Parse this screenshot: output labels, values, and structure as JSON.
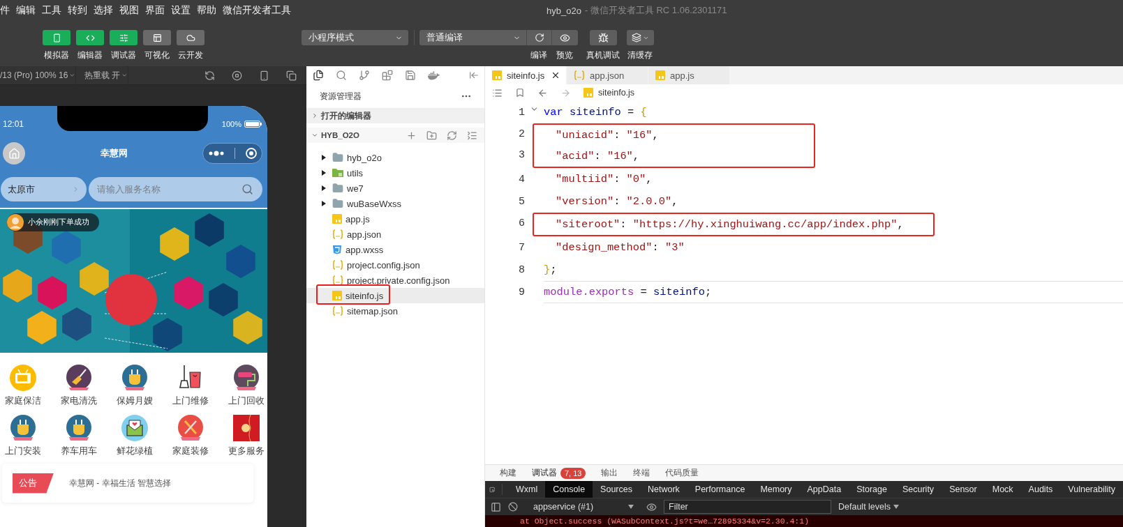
{
  "window": {
    "title": "hyb_o2o",
    "subtitle": "- 微信开发者工具 RC 1.06.2301171"
  },
  "menu": [
    "件",
    "编辑",
    "工具",
    "转到",
    "选择",
    "视图",
    "界面",
    "设置",
    "帮助",
    "微信开发者工具"
  ],
  "toolbar": {
    "views": [
      {
        "label": "模拟器",
        "selected": true
      },
      {
        "label": "编辑器",
        "selected": true
      },
      {
        "label": "调试器",
        "selected": true
      },
      {
        "label": "可视化",
        "selected": false
      },
      {
        "label": "云开发",
        "selected": false
      }
    ],
    "mode_select": "小程序模式",
    "compile_select": "普通编译",
    "actions": [
      {
        "label": "编译"
      },
      {
        "label": "预览"
      },
      {
        "label": "真机调试"
      },
      {
        "label": "清缓存"
      }
    ]
  },
  "simulator": {
    "device": "/13 (Pro) 100% 16",
    "hot_reload": "热重载 开",
    "phone": {
      "time": "12:01",
      "battery": "100%",
      "title": "幸慧网",
      "city": "太原市",
      "search_placeholder": "请输入服务名称",
      "toast": "小佘刚刚下单成功",
      "services": [
        {
          "label": "家庭保洁",
          "kind": "tv"
        },
        {
          "label": "家电清洗",
          "kind": "broom"
        },
        {
          "label": "保姆月嫂",
          "kind": "plug"
        },
        {
          "label": "上门维修",
          "kind": "bucket"
        },
        {
          "label": "上门回收",
          "kind": "roller"
        },
        {
          "label": "上门安装",
          "kind": "plug"
        },
        {
          "label": "养车用车",
          "kind": "plug"
        },
        {
          "label": "鲜花绿植",
          "kind": "envelope"
        },
        {
          "label": "家庭装修",
          "kind": "tools"
        },
        {
          "label": "更多服务",
          "kind": "packet"
        }
      ],
      "notice": {
        "badge": "公告",
        "text": "幸慧网 - 幸福生活 智慧选择"
      }
    }
  },
  "explorer": {
    "title": "资源管理器",
    "open_editors": {
      "label": "打开的编辑器",
      "expanded": false
    },
    "project": {
      "label": "HYB_O2O",
      "expanded": true,
      "children": [
        {
          "label": "hyb_o2o",
          "kind": "folder",
          "expanded": false,
          "selected": false,
          "highlighted": false
        },
        {
          "label": "utils",
          "kind": "folder-green",
          "expanded": false,
          "selected": false,
          "highlighted": false
        },
        {
          "label": "we7",
          "kind": "folder",
          "expanded": false,
          "selected": false,
          "highlighted": false
        },
        {
          "label": "wuBaseWxss",
          "kind": "folder",
          "expanded": false,
          "selected": false,
          "highlighted": false
        },
        {
          "label": "app.js",
          "kind": "js",
          "selected": false,
          "highlighted": false
        },
        {
          "label": "app.json",
          "kind": "json",
          "selected": false,
          "highlighted": false
        },
        {
          "label": "app.wxss",
          "kind": "css",
          "selected": false,
          "highlighted": false
        },
        {
          "label": "project.config.json",
          "kind": "json",
          "selected": false,
          "highlighted": false
        },
        {
          "label": "project.private.config.json",
          "kind": "json",
          "selected": false,
          "highlighted": false
        },
        {
          "label": "siteinfo.js",
          "kind": "js",
          "selected": true,
          "highlighted": true
        },
        {
          "label": "sitemap.json",
          "kind": "json",
          "selected": false,
          "highlighted": false
        }
      ]
    }
  },
  "editor": {
    "tabs": [
      {
        "label": "siteinfo.js",
        "kind": "js",
        "selected": true
      },
      {
        "label": "app.json",
        "kind": "json",
        "selected": false
      },
      {
        "label": "app.js",
        "kind": "js",
        "selected": false
      }
    ],
    "breadcrumb": {
      "label": "siteinfo.js",
      "kind": "js"
    },
    "line_groups": [
      {
        "highlighted": false,
        "lines": [
          {
            "number": "1",
            "foldable": true,
            "indented": false,
            "current": false,
            "tokens": [
              {
                "kind": "keyword",
                "text": "var"
              },
              {
                "kind": "ident",
                "text": " siteinfo"
              },
              {
                "kind": "punct",
                "text": " = "
              },
              {
                "kind": "brace",
                "text": "{"
              }
            ]
          }
        ]
      },
      {
        "highlighted": true,
        "lines": [
          {
            "number": "2",
            "foldable": false,
            "indented": true,
            "current": false,
            "tokens": [
              {
                "kind": "string",
                "text": "\"uniacid\""
              },
              {
                "kind": "punct",
                "text": ": "
              },
              {
                "kind": "string",
                "text": "\"16\""
              },
              {
                "kind": "punct",
                "text": ","
              }
            ]
          },
          {
            "number": "3",
            "foldable": false,
            "indented": true,
            "current": false,
            "tokens": [
              {
                "kind": "string",
                "text": "\"acid\""
              },
              {
                "kind": "punct",
                "text": ": "
              },
              {
                "kind": "string",
                "text": "\"16\""
              },
              {
                "kind": "punct",
                "text": ","
              }
            ]
          }
        ]
      },
      {
        "highlighted": false,
        "lines": [
          {
            "number": "4",
            "foldable": false,
            "indented": true,
            "current": false,
            "tokens": [
              {
                "kind": "string",
                "text": "\"multiid\""
              },
              {
                "kind": "punct",
                "text": ": "
              },
              {
                "kind": "string",
                "text": "\"0\""
              },
              {
                "kind": "punct",
                "text": ","
              }
            ]
          },
          {
            "number": "5",
            "foldable": false,
            "indented": true,
            "current": false,
            "tokens": [
              {
                "kind": "string",
                "text": "\"version\""
              },
              {
                "kind": "punct",
                "text": ": "
              },
              {
                "kind": "string",
                "text": "\"2.0.0\""
              },
              {
                "kind": "punct",
                "text": ","
              }
            ]
          }
        ]
      },
      {
        "highlighted": true,
        "lines": [
          {
            "number": "6",
            "foldable": false,
            "indented": true,
            "current": false,
            "tokens": [
              {
                "kind": "string",
                "text": "\"siteroot\""
              },
              {
                "kind": "punct",
                "text": ": "
              },
              {
                "kind": "string",
                "text": "\"https://hy.xinghuiwang.cc/app/index.php\""
              },
              {
                "kind": "punct",
                "text": ","
              }
            ]
          }
        ]
      },
      {
        "highlighted": false,
        "lines": [
          {
            "number": "7",
            "foldable": false,
            "indented": true,
            "current": false,
            "tokens": [
              {
                "kind": "string",
                "text": "\"design_method\""
              },
              {
                "kind": "punct",
                "text": ": "
              },
              {
                "kind": "string",
                "text": "\"3\""
              }
            ]
          },
          {
            "number": "8",
            "foldable": false,
            "indented": false,
            "current": false,
            "tokens": [
              {
                "kind": "brace",
                "text": "}"
              },
              {
                "kind": "punct",
                "text": ";"
              }
            ]
          },
          {
            "number": "9",
            "foldable": false,
            "indented": false,
            "current": true,
            "tokens": [
              {
                "kind": "builtin",
                "text": "module.exports"
              },
              {
                "kind": "punct",
                "text": " = "
              },
              {
                "kind": "ident",
                "text": "siteinfo"
              },
              {
                "kind": "punct",
                "text": ";"
              }
            ]
          }
        ]
      }
    ]
  },
  "bottom_panel": {
    "tabs": [
      {
        "label": "构建",
        "selected": false
      },
      {
        "label": "调试器",
        "selected": true,
        "badge": "7, 13"
      },
      {
        "label": "输出",
        "selected": false
      },
      {
        "label": "终端",
        "selected": false
      },
      {
        "label": "代码质量",
        "selected": false
      }
    ],
    "devtools_tabs": [
      {
        "label": "Wxml",
        "selected": false
      },
      {
        "label": "Console",
        "selected": true
      },
      {
        "label": "Sources",
        "selected": false
      },
      {
        "label": "Network",
        "selected": false
      },
      {
        "label": "Performance",
        "selected": false
      },
      {
        "label": "Memory",
        "selected": false
      },
      {
        "label": "AppData",
        "selected": false
      },
      {
        "label": "Storage",
        "selected": false
      },
      {
        "label": "Security",
        "selected": false
      },
      {
        "label": "Sensor",
        "selected": false
      },
      {
        "label": "Mock",
        "selected": false
      },
      {
        "label": "Audits",
        "selected": false
      },
      {
        "label": "Vulnerability",
        "selected": false
      }
    ],
    "console": {
      "context": "appservice (#1)",
      "filter_placeholder": "Filter",
      "levels": "Default levels",
      "error": "at Object.success (WASubContext.js?t=we…72895334&v=2.30.4:1)"
    }
  }
}
